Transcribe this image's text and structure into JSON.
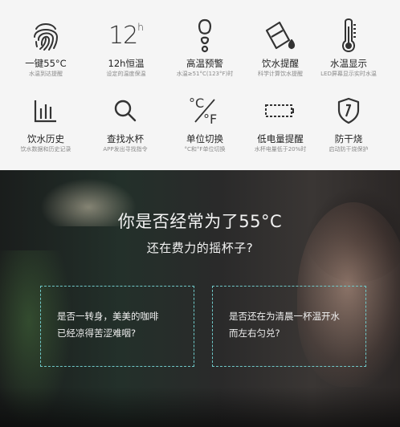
{
  "features": [
    {
      "icon": "fingerprint-icon",
      "title": "一键55°C",
      "sub": "水温到达提醒"
    },
    {
      "icon": "12h-icon",
      "icon_text": "12",
      "icon_unit": "h",
      "title": "12h恒温",
      "sub": "设定的温度保温"
    },
    {
      "icon": "footprint-warning-icon",
      "title": "高温预警",
      "sub": "水温≥51°C(123°F)时"
    },
    {
      "icon": "cup-drop-icon",
      "title": "饮水提醒",
      "sub": "科学计算饮水提醒"
    },
    {
      "icon": "thermometer-icon",
      "title": "水温显示",
      "sub": "LED屏幕显示实时水温"
    },
    {
      "icon": "bar-chart-icon",
      "title": "饮水历史",
      "sub": "饮水数据和历史记录"
    },
    {
      "icon": "magnifier-icon",
      "title": "查找水杯",
      "sub": "APP发出寻找指令"
    },
    {
      "icon": "celsius-fahrenheit-icon",
      "icon_c": "°C",
      "icon_f": "°F",
      "title": "单位切换",
      "sub": "°C和°F单位切换"
    },
    {
      "icon": "low-battery-icon",
      "title": "低电量提醒",
      "sub": "水杯电量低于20%时"
    },
    {
      "icon": "shield-icon",
      "title": "防干烧",
      "sub": "启动防干烧保护"
    }
  ],
  "banner": {
    "headline": "你是否经常为了55°C",
    "subheadline": "还在费力的摇杯子?",
    "box_left": [
      "是否一转身，美美的咖啡",
      "已经凉得苦涩难咽?"
    ],
    "box_right": [
      "是否还在为清晨一杯温开水",
      "而左右匀兑?"
    ],
    "accent_color": "#6fc8c8"
  }
}
